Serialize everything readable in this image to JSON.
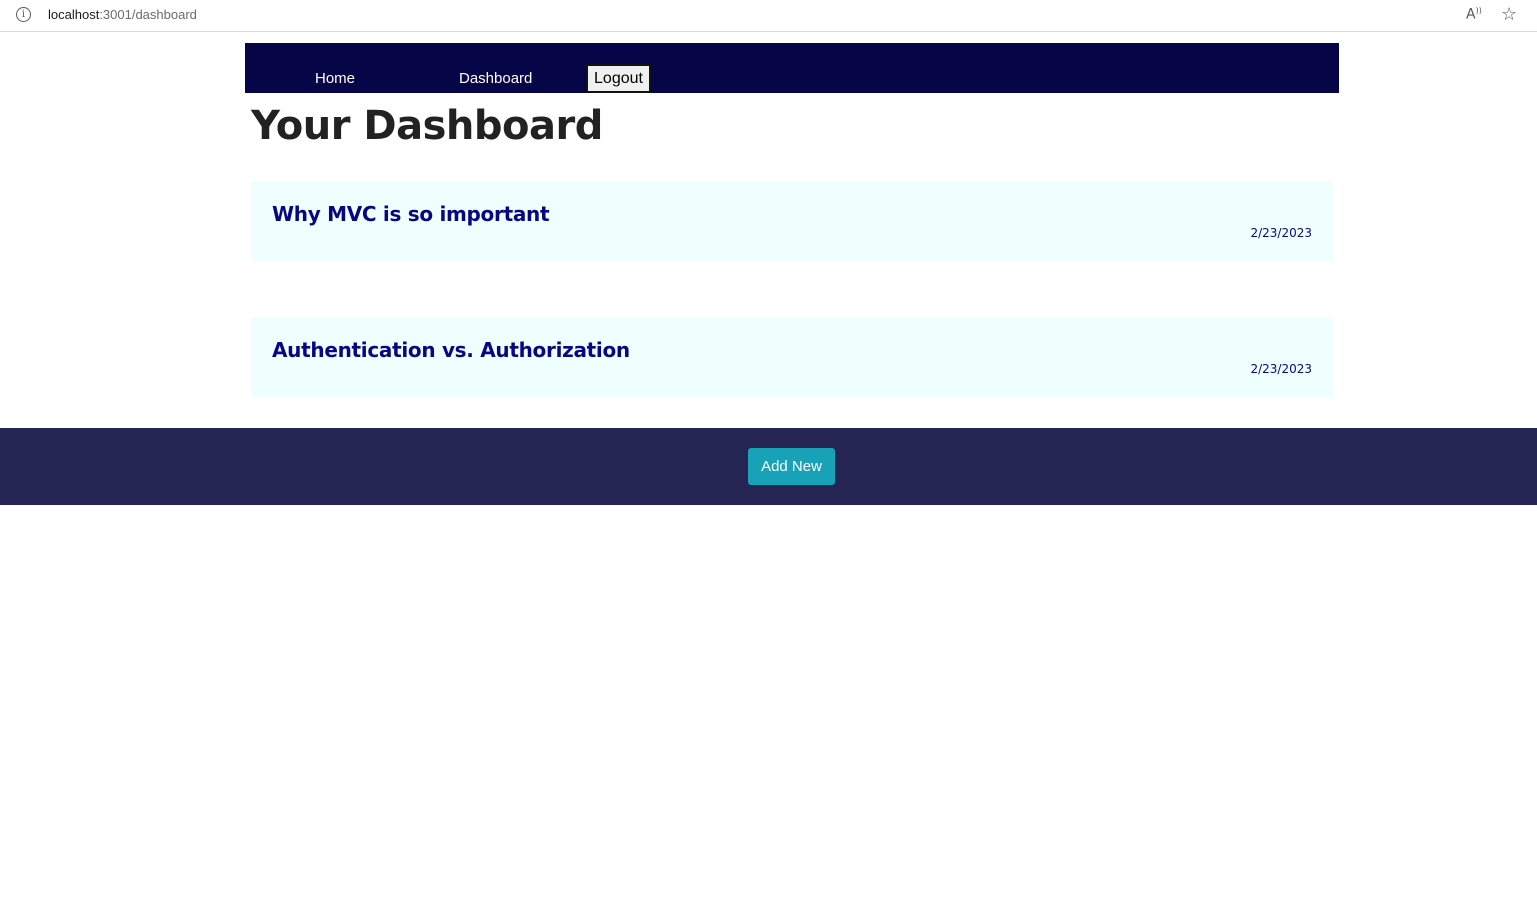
{
  "browser": {
    "url_host": "localhost",
    "url_rest": ":3001/dashboard"
  },
  "nav": {
    "home": "Home",
    "dashboard": "Dashboard",
    "logout": "Logout"
  },
  "page": {
    "title": "Your Dashboard"
  },
  "posts": [
    {
      "title": "Why MVC is so important",
      "date": "2/23/2023"
    },
    {
      "title": "Authentication vs. Authorization",
      "date": "2/23/2023"
    }
  ],
  "footer": {
    "add_new": "Add New"
  },
  "colors": {
    "nav_bg": "#050548",
    "card_bg": "#eefffe",
    "post_text": "#070784",
    "footer_bg": "#242553",
    "button_bg": "#17a2b8"
  },
  "icons": [
    "info-icon",
    "read-aloud-icon",
    "favorite-icon"
  ]
}
